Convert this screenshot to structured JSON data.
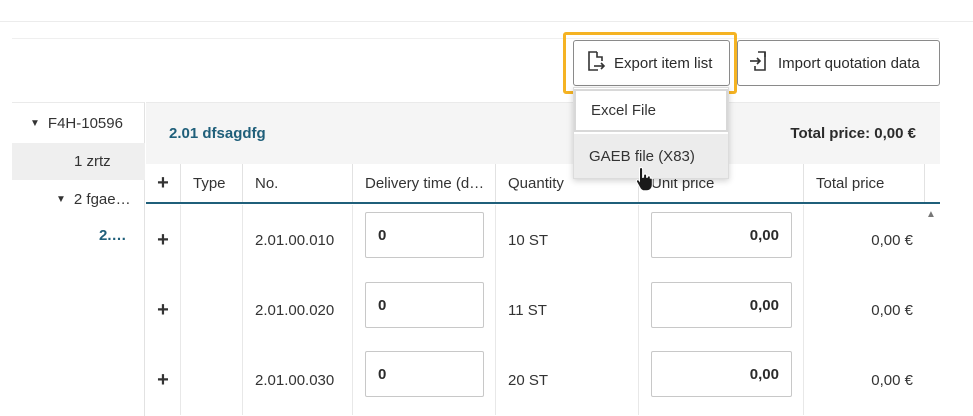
{
  "toolbar": {
    "export_label": "Export item list",
    "import_label": "Import quotation data"
  },
  "dropdown": {
    "items": [
      "Excel File",
      "GAEB file (X83)"
    ]
  },
  "tree": {
    "items": [
      {
        "label": "F4H-10596",
        "expanded": true
      },
      {
        "label": "1 zrtz"
      },
      {
        "label": "2 fgae…",
        "expanded": true
      },
      {
        "label": "2.…"
      }
    ]
  },
  "section": {
    "title": "2.01 dfsagdfg",
    "total_price": "Total price: 0,00 €"
  },
  "table": {
    "columns": [
      "+",
      "Type",
      "No.",
      "Delivery time (d…",
      "Quantity",
      "Unit price",
      "Total price"
    ],
    "rows": [
      {
        "add": "+",
        "type": "",
        "no": "2.01.00.010",
        "delivery": "0",
        "quantity": "10 ST",
        "unit_price": "0,00",
        "total": "0,00 €"
      },
      {
        "add": "+",
        "type": "",
        "no": "2.01.00.020",
        "delivery": "0",
        "quantity": "11 ST",
        "unit_price": "0,00",
        "total": "0,00 €"
      },
      {
        "add": "+",
        "type": "",
        "no": "2.01.00.030",
        "delivery": "0",
        "quantity": "20 ST",
        "unit_price": "0,00",
        "total": "0,00 €"
      }
    ]
  },
  "colors": {
    "accent": "#1f5f7a",
    "highlight": "#f5b323"
  }
}
